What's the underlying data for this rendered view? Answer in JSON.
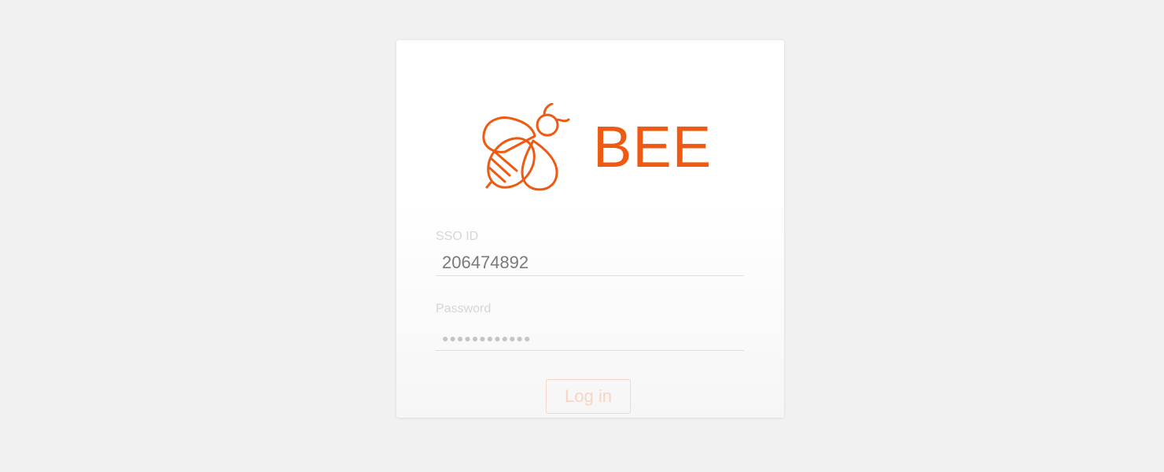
{
  "brand": {
    "logo_icon": "bee-icon",
    "name": "BEE",
    "accent_color": "#ee5a12"
  },
  "login_form": {
    "sso": {
      "label": "SSO ID",
      "value": "206474892"
    },
    "password": {
      "label": "Password",
      "masked_value": "●●●●●●●●●●●●"
    },
    "login_button": {
      "label": "Log in"
    }
  }
}
